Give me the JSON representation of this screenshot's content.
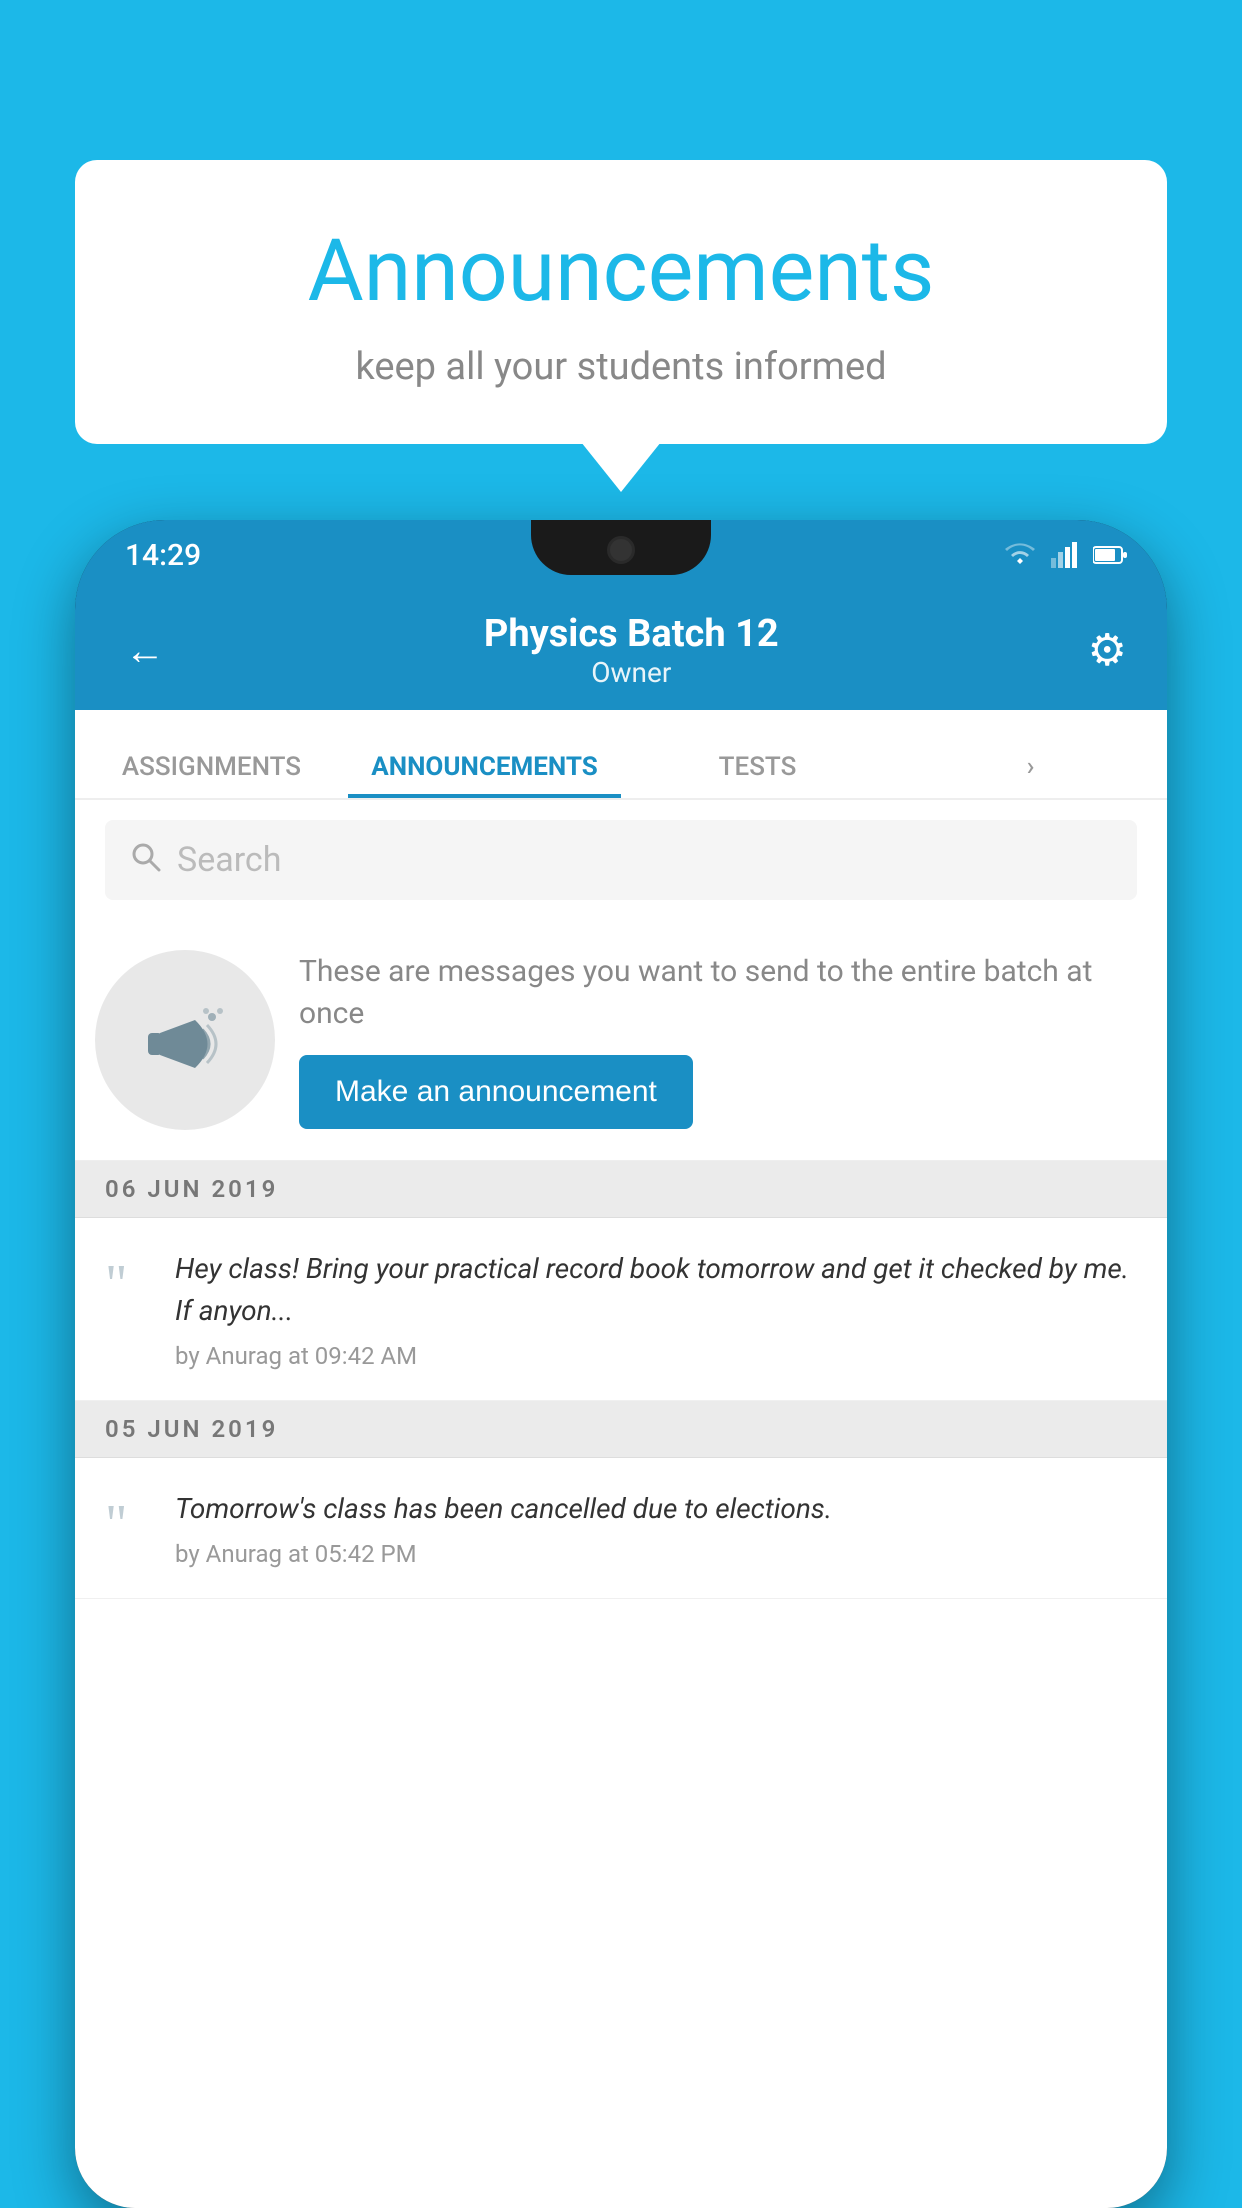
{
  "page": {
    "background_color": "#1cb8e8"
  },
  "speech_bubble": {
    "title": "Announcements",
    "subtitle": "keep all your students informed"
  },
  "status_bar": {
    "time": "14:29"
  },
  "app_bar": {
    "title": "Physics Batch 12",
    "subtitle": "Owner",
    "back_label": "←",
    "gear_label": "⚙"
  },
  "tabs": [
    {
      "label": "ASSIGNMENTS",
      "active": false
    },
    {
      "label": "ANNOUNCEMENTS",
      "active": true
    },
    {
      "label": "TESTS",
      "active": false
    },
    {
      "label": "›",
      "active": false
    }
  ],
  "search": {
    "placeholder": "Search"
  },
  "announcement_cta": {
    "description": "These are messages you want to send to the entire batch at once",
    "button_label": "Make an announcement"
  },
  "announcements": [
    {
      "date": "06  JUN  2019",
      "text": "Hey class! Bring your practical record book tomorrow and get it checked by me. If anyon...",
      "meta": "by Anurag at 09:42 AM"
    },
    {
      "date": "05  JUN  2019",
      "text": "Tomorrow's class has been cancelled due to elections.",
      "meta": "by Anurag at 05:42 PM"
    }
  ]
}
